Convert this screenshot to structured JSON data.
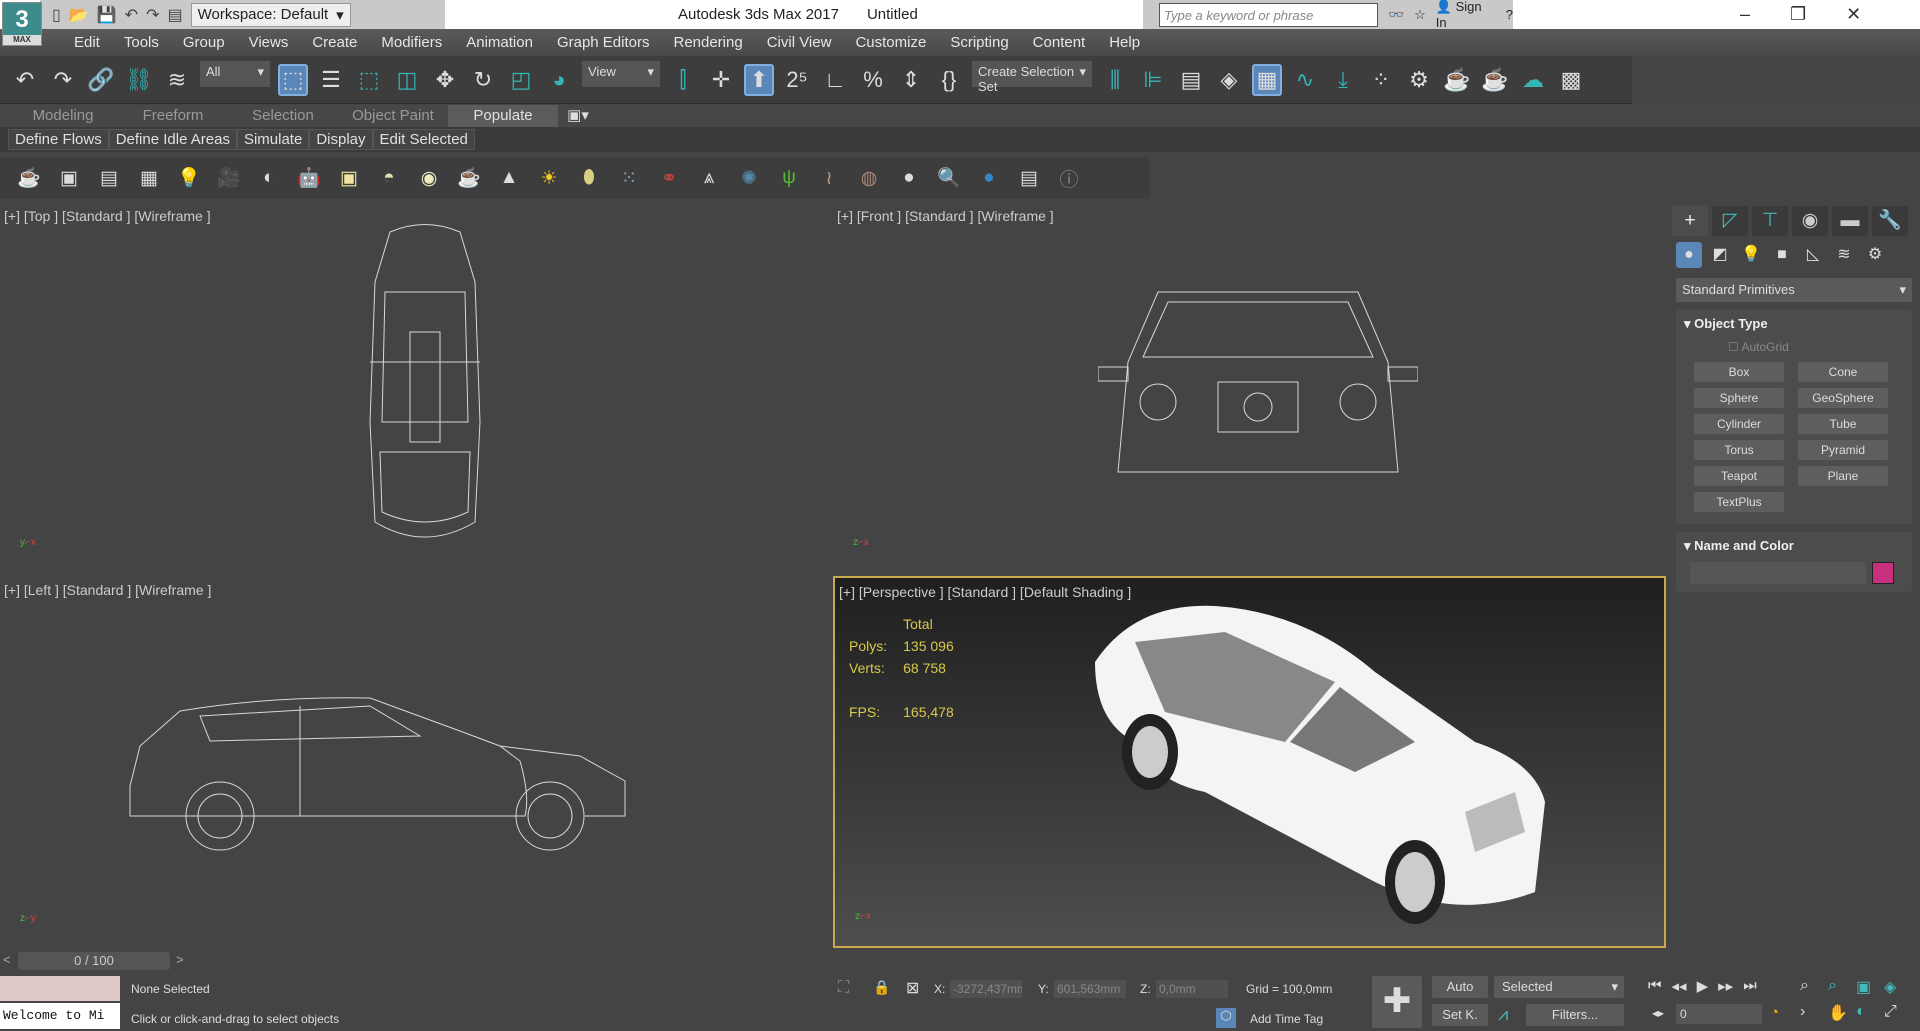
{
  "title": {
    "app": "Autodesk 3ds Max 2017",
    "doc": "Untitled",
    "logo": "3",
    "logo_sub": "MAX",
    "workspace": "Workspace: Default",
    "search_placeholder": "Type a keyword or phrase",
    "sign_in": "Sign In"
  },
  "menu": [
    "Edit",
    "Tools",
    "Group",
    "Views",
    "Create",
    "Modifiers",
    "Animation",
    "Graph Editors",
    "Rendering",
    "Civil View",
    "Customize",
    "Scripting",
    "Content",
    "Help"
  ],
  "toolbar": {
    "filter": "All",
    "ref_coord": "View",
    "selection_set": "Create Selection Set"
  },
  "ribbon_tabs": [
    "Modeling",
    "Freeform",
    "Selection",
    "Object Paint",
    "Populate"
  ],
  "ribbon_buttons": [
    "Define Flows",
    "Define Idle Areas",
    "Simulate",
    "Display",
    "Edit Selected"
  ],
  "viewports": {
    "top": "[+] [Top ] [Standard ] [Wireframe ]",
    "front": "[+] [Front ] [Standard ] [Wireframe ]",
    "left": "[+] [Left ] [Standard ] [Wireframe ]",
    "persp": "[+] [Perspective ] [Standard ] [Default Shading ]"
  },
  "stats": {
    "header": "Total",
    "polys_label": "Polys:",
    "polys": "135 096",
    "verts_label": "Verts:",
    "verts": "68 758",
    "fps_label": "FPS:",
    "fps": "165,478"
  },
  "command_panel": {
    "dropdown": "Standard Primitives",
    "object_type": "Object Type",
    "autogrid": "AutoGrid",
    "primitives": [
      "Box",
      "Cone",
      "Sphere",
      "GeoSphere",
      "Cylinder",
      "Tube",
      "Torus",
      "Pyramid",
      "Teapot",
      "Plane",
      "TextPlus"
    ],
    "name_color": "Name and Color",
    "color": "#c8307f"
  },
  "timeline": {
    "frame": "0 / 100",
    "prev": "<",
    "next": ">"
  },
  "status": {
    "listener": "Welcome to Mi",
    "selection": "None Selected",
    "prompt": "Click or click-and-drag to select objects",
    "x_label": "X:",
    "x": "-3272,437mm",
    "y_label": "Y:",
    "y": "601,563mm",
    "z_label": "Z:",
    "z": "0,0mm",
    "grid": "Grid = 100,0mm",
    "add_time_tag": "Add Time Tag",
    "auto": "Auto",
    "setk": "Set K.",
    "key_filter": "Selected",
    "filters": "Filters...",
    "frame": "0"
  }
}
